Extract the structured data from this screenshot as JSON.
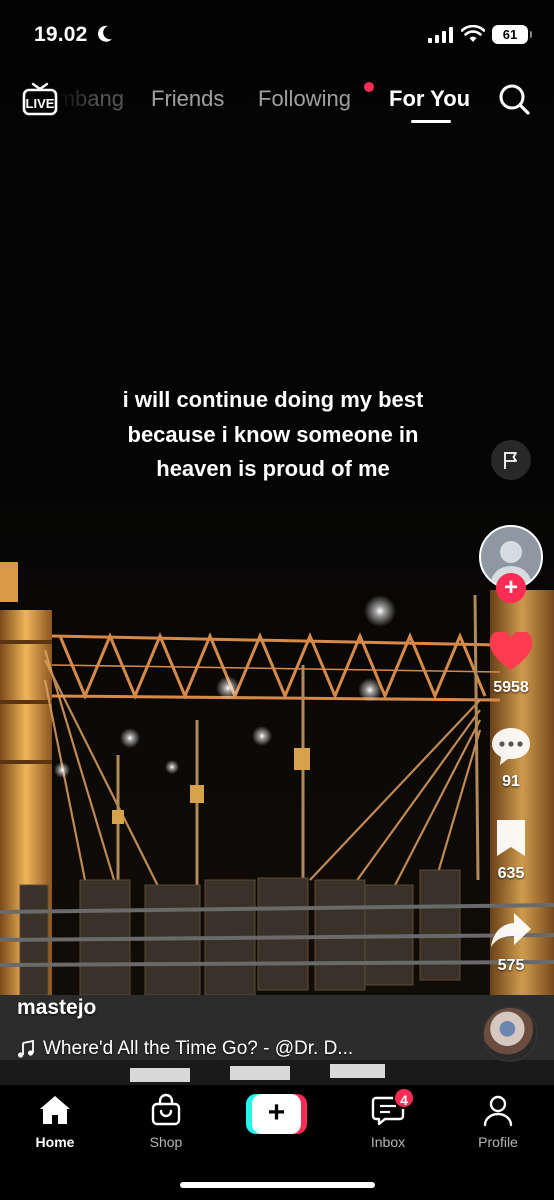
{
  "status_bar": {
    "time": "19.02",
    "battery": "61"
  },
  "top_nav": {
    "live_label": "LIVE",
    "tabs": [
      "Pembang",
      "Friends",
      "Following",
      "For You"
    ],
    "active_tab": "For You"
  },
  "video": {
    "caption": "i will continue doing my best because i know someone in heaven is proud of me",
    "author": "mastejo",
    "music": "Where'd All the Time Go? - @Dr. D..."
  },
  "actions": {
    "likes": "5958",
    "comments": "91",
    "saves": "635",
    "shares": "575"
  },
  "bottom_nav": {
    "home": "Home",
    "shop": "Shop",
    "create": "+",
    "inbox": "Inbox",
    "inbox_badge": "4",
    "profile": "Profile"
  },
  "colors": {
    "accent_red": "#fe2c55",
    "accent_cyan": "#25f4ee",
    "like_red": "#ff3b4f"
  }
}
